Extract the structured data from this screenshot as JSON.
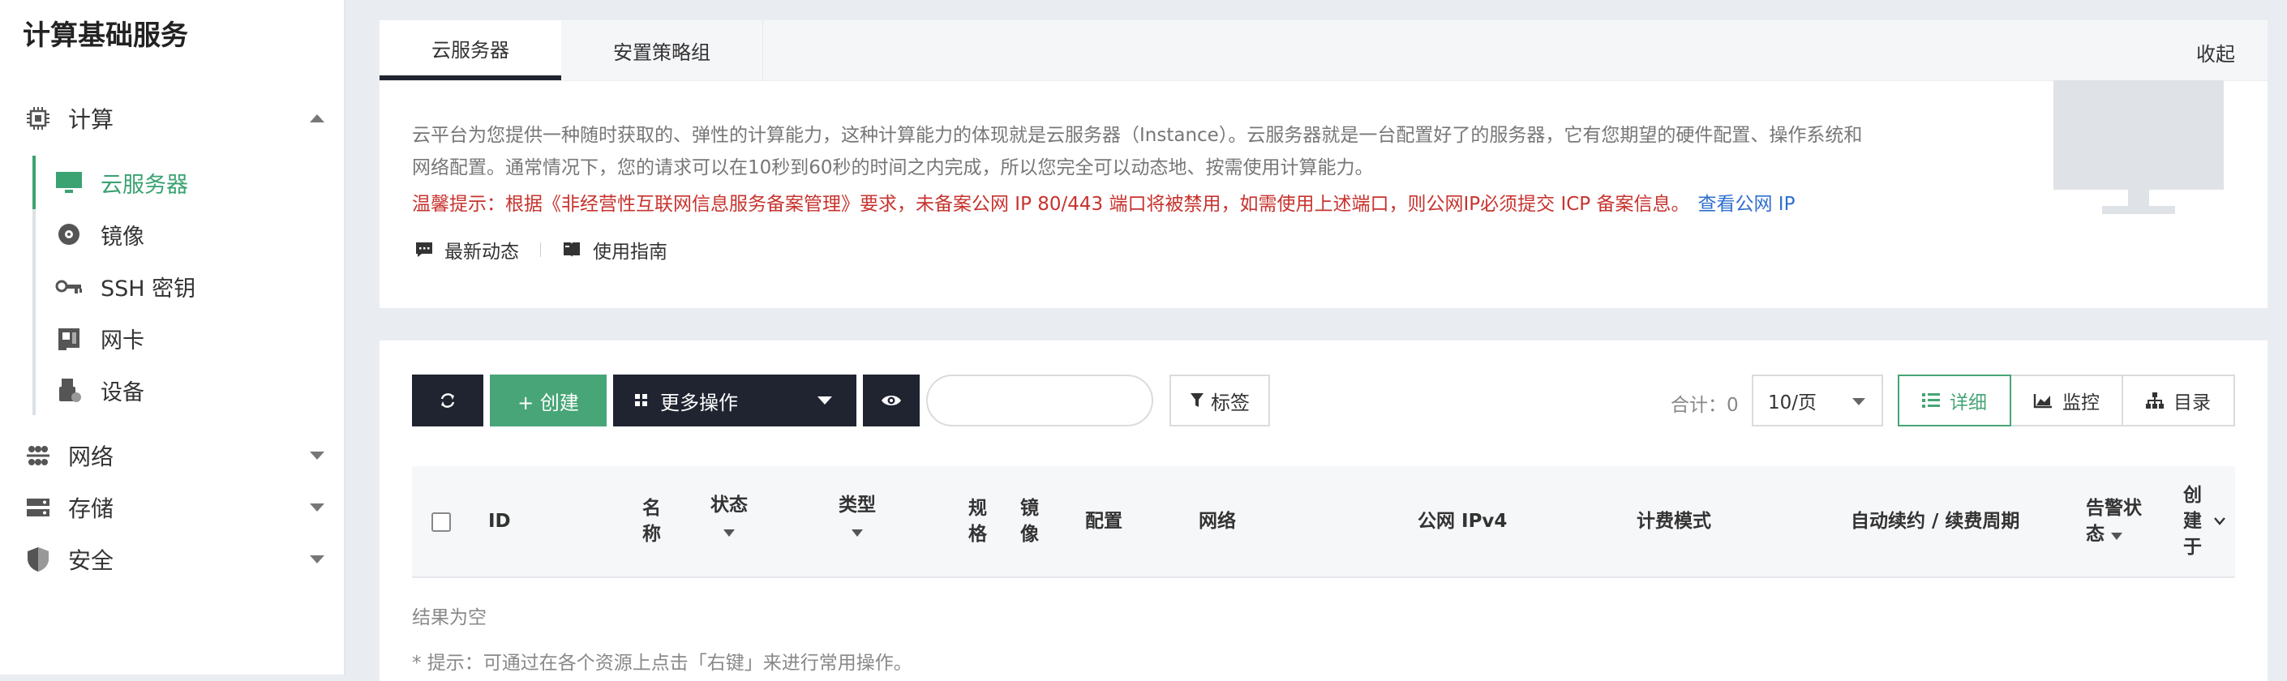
{
  "sidebar": {
    "title": "计算基础服务",
    "groups": [
      {
        "label": "计算",
        "icon": "chip-icon",
        "expanded": true
      },
      {
        "label": "网络",
        "icon": "network-icon"
      },
      {
        "label": "存储",
        "icon": "storage-icon"
      },
      {
        "label": "安全",
        "icon": "shield-icon"
      }
    ],
    "compute_items": [
      {
        "label": "云服务器",
        "icon": "monitor-icon",
        "active": true
      },
      {
        "label": "镜像",
        "icon": "disc-icon"
      },
      {
        "label": "SSH 密钥",
        "icon": "key-icon"
      },
      {
        "label": "网卡",
        "icon": "nic-icon"
      },
      {
        "label": "设备",
        "icon": "usb-device-icon"
      }
    ]
  },
  "overview": {
    "tabs": [
      "云服务器",
      "安置策略组"
    ],
    "collapse_label": "收起",
    "intro_line1": "云平台为您提供一种随时获取的、弹性的计算能力，这种计算能力的体现就是云服务器（Instance）。云服务器就是一台配置好了的服务器，它有您期望的硬件配置、操作系统和",
    "intro_line2": "网络配置。通常情况下，您的请求可以在10秒到60秒的时间之内完成，所以您完全可以动态地、按需使用计算能力。",
    "warning": "温馨提示：根据《非经营性互联网信息服务备案管理》要求，未备案公网 IP 80/443 端口将被禁用，如需使用上述端口，则公网IP必须提交 ICP 备案信息。",
    "warning_link": "查看公网 IP",
    "link_news": "最新动态",
    "link_guide": "使用指南"
  },
  "toolbar": {
    "create_label": "+ 创建",
    "more_label": "更多操作",
    "search_placeholder": "",
    "tag_label": "标签",
    "total_label": "合计：0",
    "page_size": "10/页",
    "views": [
      "详细",
      "监控",
      "目录"
    ]
  },
  "table": {
    "headers": {
      "id": "ID",
      "name_1": "名",
      "name_2": "称",
      "status": "状态",
      "type": "类型",
      "spec_1": "规",
      "spec_2": "格",
      "image_1": "镜",
      "image_2": "像",
      "config": "配置",
      "network": "网络",
      "public_ip": "公网 IPv4",
      "billing": "计费模式",
      "renew": "自动续约 / 续费周期",
      "alarm_1": "告警状",
      "alarm_2": "态",
      "created_1": "创",
      "created_2": "建",
      "created_3": "于"
    },
    "empty_text": "结果为空",
    "tip_text": "* 提示：可通过在各个资源上点击「右键」来进行常用操作。"
  },
  "colors": {
    "accent": "#3ba272",
    "dark": "#1f2430",
    "warning": "#c7332e",
    "link": "#2f6fcf"
  }
}
